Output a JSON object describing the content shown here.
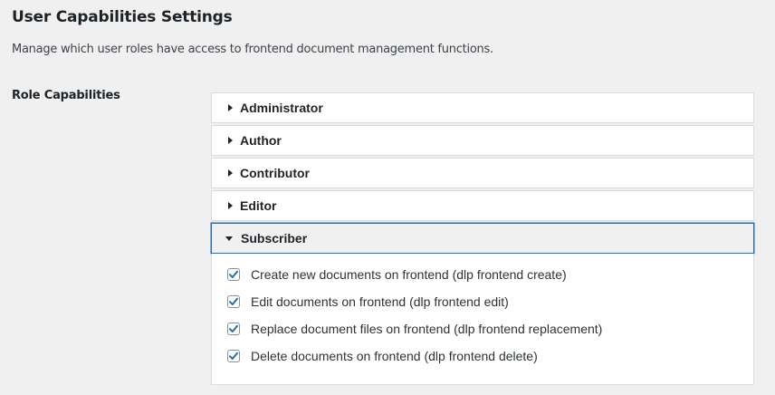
{
  "page": {
    "title": "User Capabilities Settings",
    "description": "Manage which user roles have access to frontend document management functions."
  },
  "role_capabilities": {
    "label": "Role Capabilities",
    "roles": [
      {
        "name": "Administrator",
        "expanded": false
      },
      {
        "name": "Author",
        "expanded": false
      },
      {
        "name": "Contributor",
        "expanded": false
      },
      {
        "name": "Editor",
        "expanded": false
      },
      {
        "name": "Subscriber",
        "expanded": true
      }
    ],
    "subscriber_capabilities": [
      {
        "label": "Create new documents on frontend (dlp frontend create)",
        "checked": true
      },
      {
        "label": "Edit documents on frontend (dlp frontend edit)",
        "checked": true
      },
      {
        "label": "Replace document files on frontend (dlp frontend replacement)",
        "checked": true
      },
      {
        "label": "Delete documents on frontend (dlp frontend delete)",
        "checked": true
      }
    ]
  },
  "colors": {
    "accent": "#2271b1",
    "background": "#f0f0f1",
    "panel": "#ffffff",
    "border": "#dcdcde"
  },
  "icons": {
    "collapsed": "caret-right-icon",
    "expanded": "caret-down-icon",
    "checked": "checkmark-icon"
  }
}
